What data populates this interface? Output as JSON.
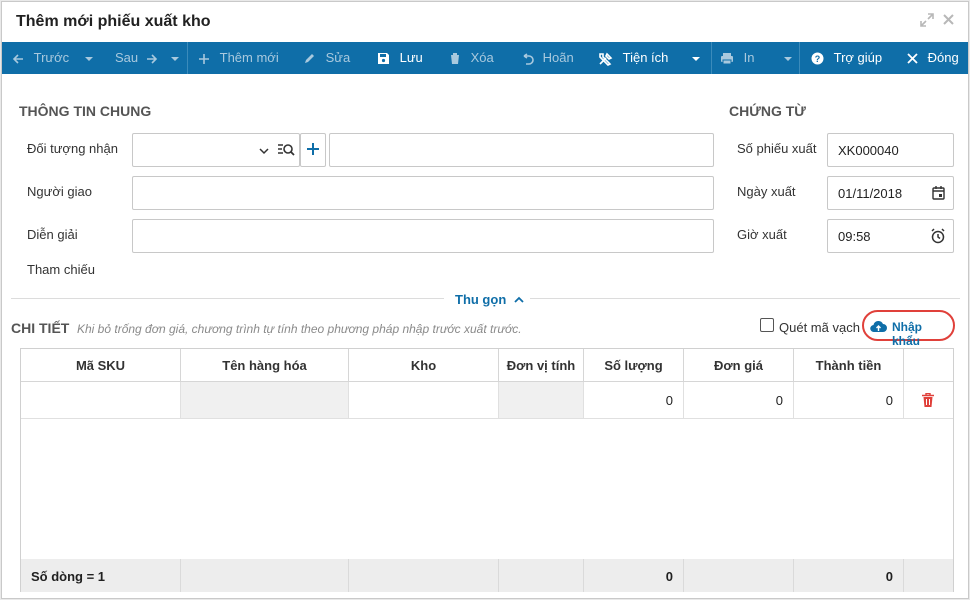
{
  "window": {
    "title": "Thêm mới phiếu xuất kho"
  },
  "toolbar": {
    "prev_label": "Trước",
    "next_label": "Sau",
    "add_label": "Thêm mới",
    "edit_label": "Sửa",
    "save_label": "Lưu",
    "delete_label": "Xóa",
    "undo_label": "Hoãn",
    "utility_label": "Tiện ích",
    "print_label": "In",
    "help_label": "Trợ giúp",
    "close_label": "Đóng"
  },
  "general": {
    "title": "THÔNG TIN CHUNG",
    "recipient_label": "Đối tượng nhận",
    "recipient_value": "",
    "recipient_name_value": "",
    "deliverer_label": "Người giao",
    "deliverer_value": "",
    "description_label": "Diễn giải",
    "description_value": "",
    "reference_label": "Tham chiếu"
  },
  "voucher": {
    "title": "CHỨNG TỪ",
    "number_label": "Số phiếu xuất",
    "number_value": "XK000040",
    "date_label": "Ngày xuất",
    "date_value": "01/11/2018",
    "time_label": "Giờ xuất",
    "time_value": "09:58"
  },
  "collapse_label": "Thu gọn",
  "detail": {
    "title": "CHI TIẾT",
    "hint": "Khi bỏ trống đơn giá, chương trình tự tính theo phương pháp nhập trước xuất trước.",
    "barcode_label": "Quét mã vạch",
    "barcode_checked": false,
    "import_label": "Nhập khẩu"
  },
  "table": {
    "columns": [
      "Mã SKU",
      "Tên hàng hóa",
      "Kho",
      "Đơn vị tính",
      "Số lượng",
      "Đơn giá",
      "Thành tiền"
    ],
    "rows": [
      {
        "sku": "",
        "name": "",
        "warehouse": "",
        "unit": "",
        "quantity": "0",
        "price": "0",
        "amount": "0"
      }
    ],
    "footer": {
      "row_count": "Số dòng = 1",
      "quantity_total": "0",
      "amount_total": "0"
    }
  },
  "colors": {
    "toolbar_bg": "#0f6ea8",
    "accent": "#0f6ea8",
    "highlight": "#e0403a",
    "delete": "#e0403a"
  }
}
